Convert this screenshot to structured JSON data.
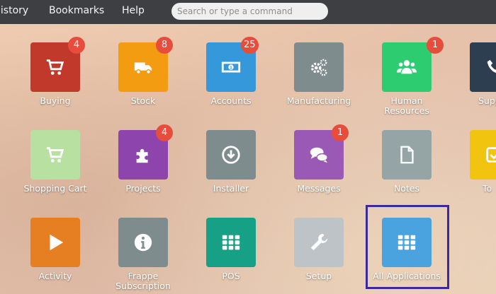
{
  "topbar": {
    "menu": [
      "listory",
      "Bookmarks",
      "Help"
    ],
    "search_placeholder": "Search or type a command"
  },
  "apps": {
    "buying": {
      "label": "Buying",
      "badge": "4",
      "color": "#c0392b",
      "icon": "cart-icon"
    },
    "stock": {
      "label": "Stock",
      "badge": "8",
      "color": "#f39c12",
      "icon": "truck-icon"
    },
    "accounts": {
      "label": "Accounts",
      "badge": "25",
      "color": "#3498db",
      "icon": "money-icon"
    },
    "manufacturing": {
      "label": "Manufacturing",
      "color": "#7f8c8d",
      "icon": "gears-icon"
    },
    "human_resources": {
      "label": "Human Resources",
      "badge": "1",
      "color": "#2ecc71",
      "icon": "users-icon"
    },
    "support": {
      "label": "Supp",
      "color": "#2c3e50",
      "icon": "phone-icon"
    },
    "shopping_cart": {
      "label": "Shopping Cart",
      "color": "#b8e0a0",
      "icon": "cart-icon"
    },
    "projects": {
      "label": "Projects",
      "badge": "4",
      "color": "#8e44ad",
      "icon": "puzzle-icon"
    },
    "installer": {
      "label": "Installer",
      "color": "#7f8c8d",
      "icon": "download-icon"
    },
    "messages": {
      "label": "Messages",
      "badge": "1",
      "color": "#9b59b6",
      "icon": "chat-icon"
    },
    "notes": {
      "label": "Notes",
      "color": "#95a5a6",
      "icon": "file-icon"
    },
    "todo": {
      "label": "To",
      "color": "#f1c40f",
      "icon": "check-icon"
    },
    "activity": {
      "label": "Activity",
      "color": "#e67e22",
      "icon": "play-icon"
    },
    "frappe_subscription": {
      "label": "Frappe Subscription",
      "color": "#7f8c8d",
      "icon": "info-icon"
    },
    "pos": {
      "label": "POS",
      "color": "#16a085",
      "icon": "grid-icon"
    },
    "setup": {
      "label": "Setup",
      "color": "#bdc3c7",
      "icon": "wrench-icon"
    },
    "all_applications": {
      "label": "All Applications",
      "color": "#4aa3df",
      "icon": "grid-icon"
    }
  }
}
